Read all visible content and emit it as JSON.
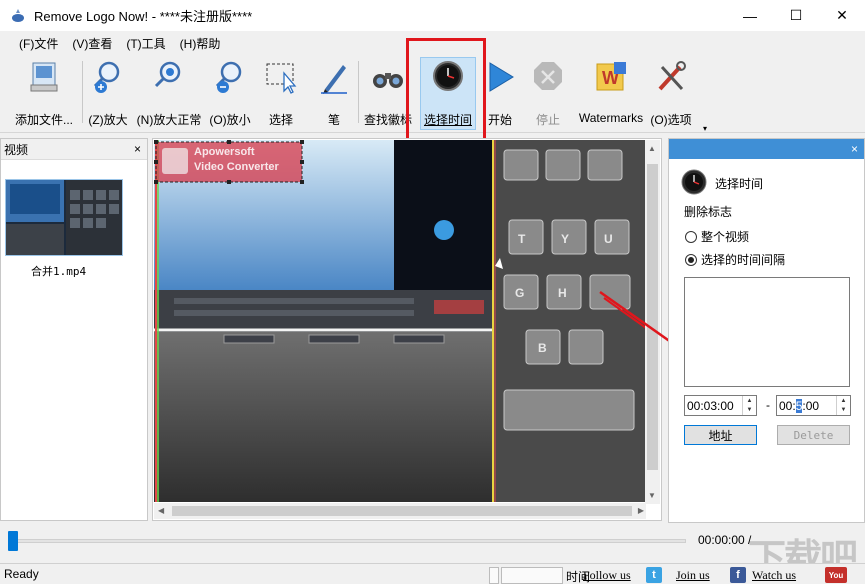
{
  "window": {
    "title": "Remove Logo Now! - ****未注册版****",
    "minimize_glyph": "—",
    "maximize_glyph": "☐",
    "close_glyph": "✕"
  },
  "menu": {
    "items": [
      {
        "label": "(F)文件"
      },
      {
        "label": "(V)查看"
      },
      {
        "label": "(T)工具"
      },
      {
        "label": "(H)帮助"
      }
    ]
  },
  "toolbar": {
    "add_file": "添加文件...",
    "zoom_in": "(Z)放大",
    "zoom_normal": "(N)放大正常",
    "zoom_out": "(O)放小",
    "select": "选择",
    "pen": "笔",
    "find_logo": "查找徽标",
    "select_time": "选择时间",
    "start": "开始",
    "stop": "停止",
    "watermarks": "Watermarks",
    "options": "(O)选项",
    "overflow_glyph": "▾"
  },
  "left_panel": {
    "title": "视频",
    "close_glyph": "×",
    "file_name": "合并1.mp4"
  },
  "video": {
    "overlay_brand": "Apowersoft",
    "overlay_product": "Video Converter"
  },
  "right_panel": {
    "close_glyph": "×",
    "title": "选择时间",
    "remove_label": "删除标志",
    "radio_whole": "整个视频",
    "radio_interval": "选择的时间间隔",
    "selected_radio": "radio_interval",
    "start_time": "00:03:00",
    "end_time_prefix": "00:",
    "end_time_selected": "5",
    "end_time_suffix": ":00",
    "dash": "-",
    "address_button": "地址",
    "delete_button": "Delete"
  },
  "timeline": {
    "readout": "00:00:00 /",
    "position_fraction": 0.0
  },
  "statusbar": {
    "ready": "Ready",
    "time_label": "时间",
    "follow_us": "Follow us",
    "join_us": "Join us",
    "watch_us": "Watch us",
    "twitter_glyph": "t",
    "facebook_glyph": "f",
    "youtube_glyph": "You"
  },
  "watermark_text": "下载吧",
  "colors": {
    "highlight_red": "#e0161c",
    "accent_blue": "#0078d7",
    "panel_header_blue": "#3f8fd6",
    "active_tool_bg": "#cce4f7"
  }
}
